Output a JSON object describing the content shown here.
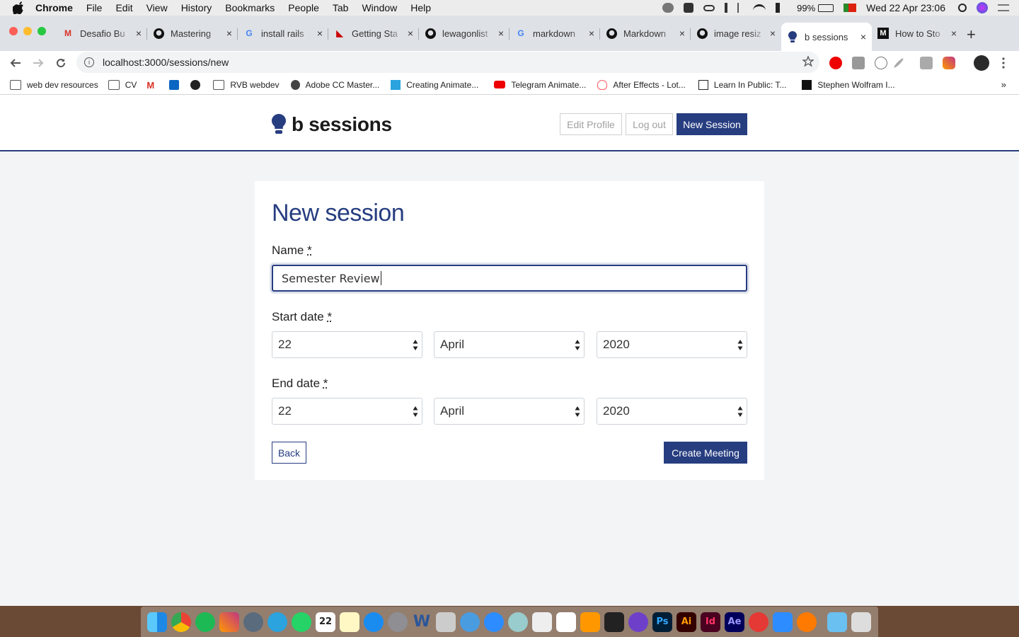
{
  "menubar": {
    "app": "Chrome",
    "items": [
      "File",
      "Edit",
      "View",
      "History",
      "Bookmarks",
      "People",
      "Tab",
      "Window",
      "Help"
    ],
    "battery": "99%",
    "datetime": "Wed 22 Apr  23:06"
  },
  "tabs": [
    {
      "title": "Desafio Bu",
      "icon": "gmail-icon"
    },
    {
      "title": "Mastering",
      "icon": "github-icon"
    },
    {
      "title": "install rails",
      "icon": "google-icon"
    },
    {
      "title": "Getting Sta",
      "icon": "rails-icon"
    },
    {
      "title": "lewagonlist",
      "icon": "github-icon"
    },
    {
      "title": "markdown",
      "icon": "google-icon"
    },
    {
      "title": "Markdown",
      "icon": "github-icon"
    },
    {
      "title": "image resiz",
      "icon": "github-icon"
    },
    {
      "title": "b sessions",
      "icon": "bulb-icon",
      "active": true
    },
    {
      "title": "How to Sto",
      "icon": "medium-icon"
    }
  ],
  "omnibox": {
    "url": "localhost:3000/sessions/new"
  },
  "bookmarks": [
    {
      "label": "web dev resources",
      "icon": "folder-icon"
    },
    {
      "label": "CV",
      "icon": "folder-icon"
    },
    {
      "label": "",
      "icon": "gmail-icon"
    },
    {
      "label": "",
      "icon": "linkedin-icon"
    },
    {
      "label": "",
      "icon": "github-icon"
    },
    {
      "label": "RVB webdev",
      "icon": "folder-icon"
    },
    {
      "label": "Adobe CC Master...",
      "icon": "udemy-icon"
    },
    {
      "label": "Creating Animate...",
      "icon": "telegram-icon"
    },
    {
      "label": "Telegram Animate...",
      "icon": "youtube-icon"
    },
    {
      "label": "After Effects - Lot...",
      "icon": "airbnb-icon"
    },
    {
      "label": "Learn In Public: T...",
      "icon": "swyx-icon"
    },
    {
      "label": "Stephen Wolfram I...",
      "icon": "wolfram-icon"
    }
  ],
  "app": {
    "brand": "b sessions",
    "nav": {
      "edit_profile": "Edit Profile",
      "log_out": "Log out",
      "new_session": "New Session"
    }
  },
  "form": {
    "title": "New session",
    "name_label": "Name",
    "required_mark": "*",
    "name_value": "Semester Review",
    "start_label": "Start date",
    "end_label": "End date",
    "start": {
      "day": "22",
      "month": "April",
      "year": "2020"
    },
    "end": {
      "day": "22",
      "month": "April",
      "year": "2020"
    },
    "back": "Back",
    "submit": "Create Meeting"
  },
  "dock": [
    "finder-icon",
    "chrome-icon",
    "spotify-icon",
    "instagram-icon",
    "screenshot-icon",
    "telegram-icon",
    "whatsapp-icon",
    "calendar-icon",
    "notes-icon",
    "appstore-icon",
    "settings-icon",
    "word-icon",
    "script-icon",
    "quicktime-icon",
    "zoom-icon",
    "safari-icon",
    "textedit-icon",
    "slack-icon",
    "sublime-icon",
    "terminal-icon",
    "github-desktop-icon",
    "photoshop-icon",
    "illustrator-icon",
    "indesign-icon",
    "aftereffects-icon",
    "hand-icon",
    "zoom-video-icon",
    "transmit-icon",
    "folder-icon",
    "trash-icon"
  ],
  "dock_labels": {
    "calendar": "22",
    "word": "W",
    "photoshop": "Ps",
    "illustrator": "Ai",
    "indesign": "Id",
    "aftereffects": "Ae"
  }
}
